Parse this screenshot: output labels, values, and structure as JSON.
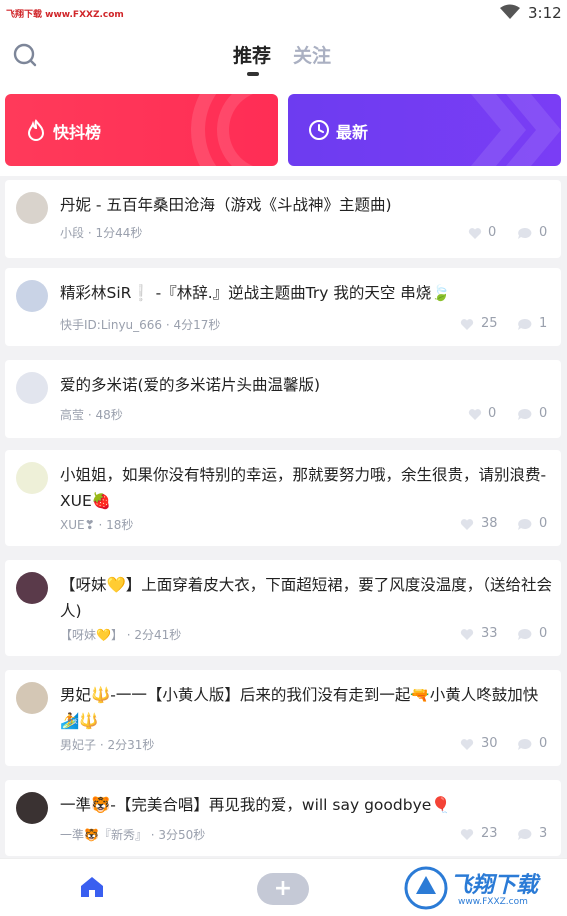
{
  "status_bar": {
    "watermark": "飞翔下载 www.FXXZ.com",
    "time": "3:12"
  },
  "top_nav": {
    "tabs": [
      {
        "label": "推荐"
      },
      {
        "label": "关注"
      }
    ]
  },
  "banners": [
    {
      "label": "快抖榜",
      "color": "#ff2d55"
    },
    {
      "label": "最新",
      "color": "#7a3df5"
    }
  ],
  "feed": [
    {
      "title": "丹妮 - 五百年桑田沧海（游戏《斗战神》主题曲)",
      "author": "小段",
      "time": "1分44秒",
      "likes": "0",
      "comments": "0"
    },
    {
      "title": "精彩林SiR❕ -『林辞.』逆战主题曲Try 我的天空 串烧🍃",
      "author": "快手ID:Linyu_666",
      "time": "4分17秒",
      "likes": "25",
      "comments": "1"
    },
    {
      "title": "爱的多米诺(爱的多米诺片头曲温馨版)",
      "author": "高莹",
      "time": "48秒",
      "likes": "0",
      "comments": "0"
    },
    {
      "title": "小姐姐，如果你没有特别的幸运，那就要努力哦，余生很贵，请别浪费-XUE🍓",
      "author": "XUE❣",
      "time": "18秒",
      "likes": "38",
      "comments": "0"
    },
    {
      "title": "【呀妹💛】上面穿着皮大衣，下面超短裙，要了风度没温度，（送给社会人)",
      "author": "【呀妹💛】",
      "time": "2分41秒",
      "likes": "33",
      "comments": "0"
    },
    {
      "title": "男妃🔱-一一【小黄人版】后来的我们没有走到一起🔫小黄人咚鼓加快🏄🔱",
      "author": "男妃子",
      "time": "2分31秒",
      "likes": "30",
      "comments": "0"
    },
    {
      "title": "一準🐯-【完美合唱】再见我的爱，will say goodbye🎈",
      "author": "一準🐯『新秀』",
      "time": "3分50秒",
      "likes": "23",
      "comments": "3"
    }
  ],
  "bottom_watermark": {
    "text": "飞翔下载",
    "url": "www.FXXZ.com"
  },
  "colors": {
    "accent_red": "#ff2d55",
    "accent_purple": "#7a3df5",
    "nav_active": "#3a5ff0"
  },
  "icons": [
    "search-icon",
    "wifi-icon",
    "flame-icon",
    "clock-icon",
    "heart-icon",
    "comment-icon",
    "home-icon",
    "plus-icon"
  ]
}
